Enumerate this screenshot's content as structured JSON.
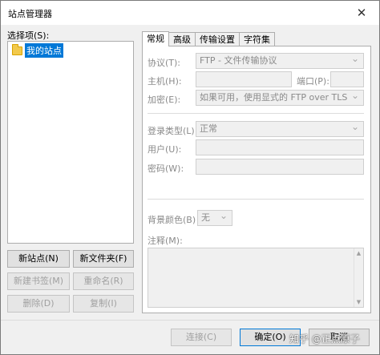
{
  "window": {
    "title": "站点管理器",
    "close_glyph": "✕"
  },
  "left": {
    "select_label": "选择项(S):",
    "tree": [
      {
        "label": "我的站点",
        "icon": "folder-icon",
        "selected": true
      }
    ],
    "buttons": {
      "new_site": "新站点(N)",
      "new_folder": "新文件夹(F)",
      "new_bookmark": "新建书签(M)",
      "rename": "重命名(R)",
      "delete": "删除(D)",
      "copy": "复制(I)"
    }
  },
  "tabs": [
    {
      "label": "常规",
      "active": true
    },
    {
      "label": "高级",
      "active": false
    },
    {
      "label": "传输设置",
      "active": false
    },
    {
      "label": "字符集",
      "active": false
    }
  ],
  "general": {
    "protocol_label": "协议(T):",
    "protocol_value": "FTP - 文件传输协议",
    "host_label": "主机(H):",
    "host_value": "",
    "port_label": "端口(P):",
    "port_value": "",
    "encryption_label": "加密(E):",
    "encryption_value": "如果可用，使用显式的 FTP over TLS",
    "logon_type_label": "登录类型(L):",
    "logon_type_value": "正常",
    "user_label": "用户(U):",
    "user_value": "",
    "password_label": "密码(W):",
    "password_value": "",
    "bg_color_label": "背景颜色(B)",
    "bg_color_value": "无",
    "comments_label": "注释(M):",
    "comments_value": ""
  },
  "footer": {
    "connect": "连接(C)",
    "ok": "确定(O)",
    "cancel": "取消",
    "watermark": "知乎 @正点原子"
  },
  "colors": {
    "selection": "#0078d7",
    "folder": "#f2c94c",
    "disabled_text": "#a0a0a0"
  }
}
